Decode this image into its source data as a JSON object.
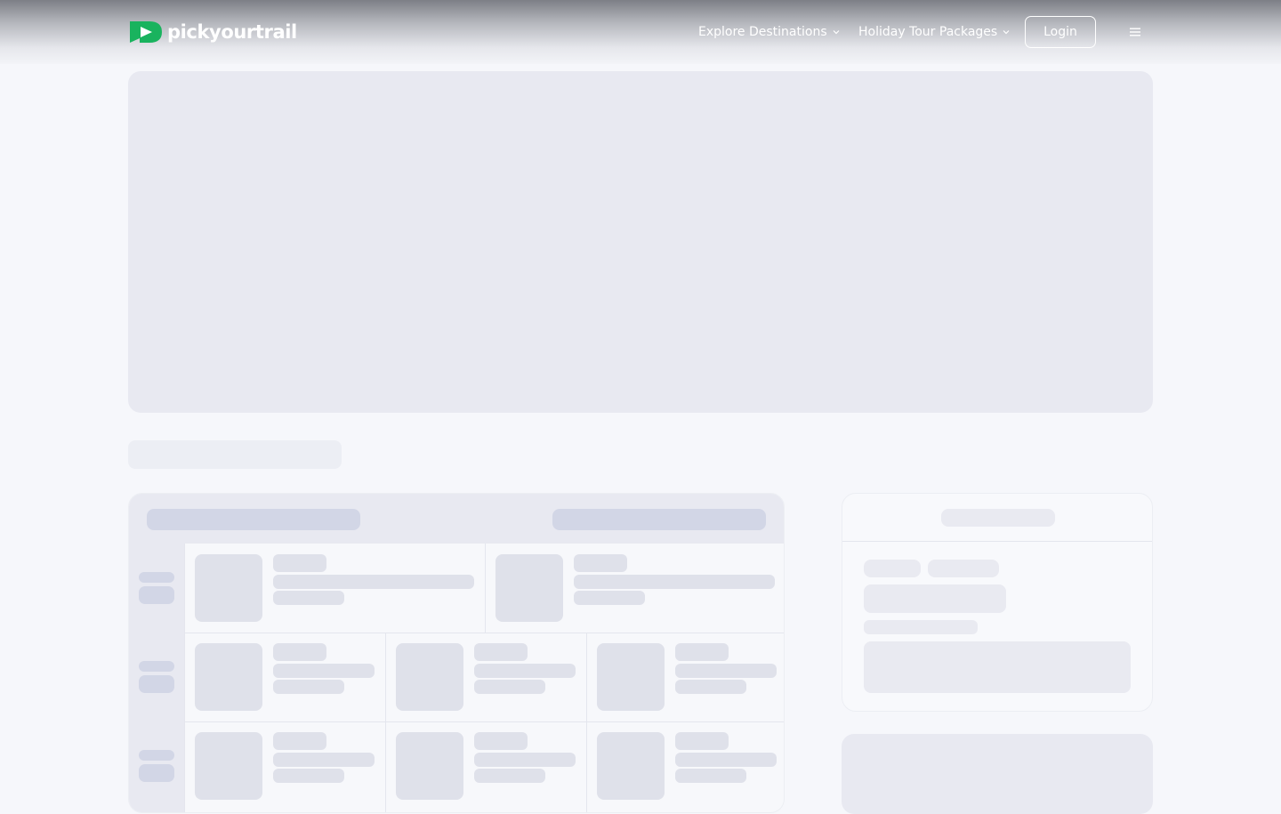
{
  "header": {
    "logo_text": "pickyourtrail",
    "nav": [
      {
        "label": "Explore Destinations",
        "icon": "chevron-down-icon"
      },
      {
        "label": "Holiday Tour Packages",
        "icon": "chevron-down-icon"
      }
    ],
    "login_label": "Login",
    "menu_icon": "hamburger-menu-icon"
  },
  "colors": {
    "brand_green": "#19b35e",
    "background": "#f6f7fb",
    "skeleton": "#e6e8f0",
    "skeleton_dark": "#d2d6e6"
  },
  "page_state": "loading-skeleton"
}
